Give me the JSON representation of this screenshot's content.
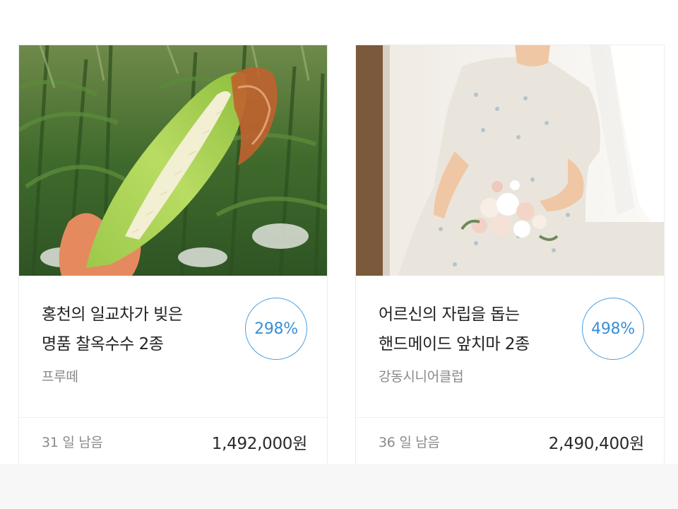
{
  "cards": [
    {
      "image_alt": "corn-photo",
      "title_line1": "홍천의 일교차가 빚은",
      "title_line2": "명품 찰옥수수 2종",
      "maker": "프루떼",
      "rate": "298%",
      "days_left": "31 일 남음",
      "amount": "1,492,000원"
    },
    {
      "image_alt": "apron-photo",
      "title_line1": "어르신의 자립을 돕는",
      "title_line2": "핸드메이드 앞치마 2종",
      "maker": "강동시니어클럽",
      "rate": "498%",
      "days_left": "36 일 남음",
      "amount": "2,490,400원"
    }
  ],
  "colors": {
    "accent": "#3a8fd6",
    "badge_border": "#4a9fe0",
    "title_text": "#222222",
    "muted_text": "#888888",
    "background_band": "#f7f7f7"
  }
}
